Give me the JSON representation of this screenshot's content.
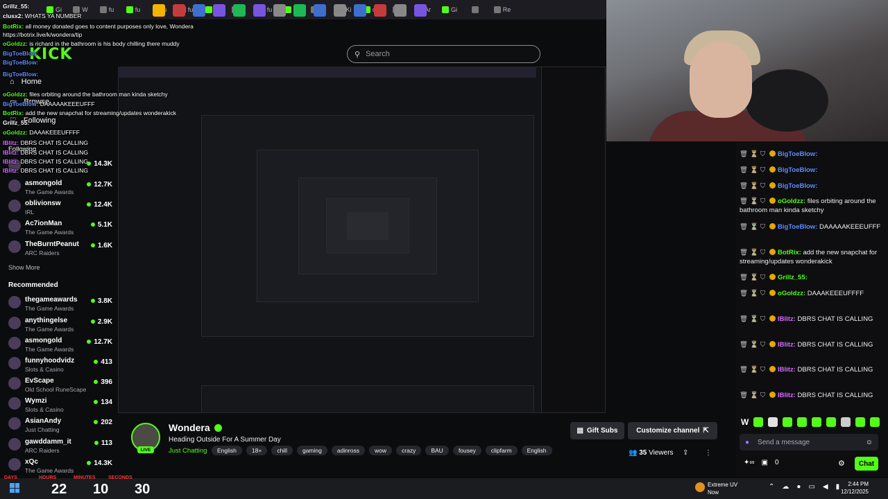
{
  "browser": {
    "tabs": [
      "Gi",
      "W",
      "fu",
      "fu",
      "fu",
      "fu",
      "fu",
      "fu",
      "fu",
      "fu",
      "fu",
      "Ki",
      "di",
      "",
      "Ar",
      "Gi",
      "",
      "Re"
    ]
  },
  "search": {
    "placeholder": "Search"
  },
  "overlay": {
    "lines": [
      {
        "user": "Grillz_55:",
        "text": "",
        "color": "#ffffff"
      },
      {
        "user": "clusx2:",
        "text": "WHATS YA NUMBER",
        "color": "#ffffff"
      },
      {
        "user": "BotRix:",
        "text": "all money donated goes to content purposes only love, Wondera",
        "color": "#53fc18"
      },
      {
        "user": "",
        "text": "https://botrix.live/k/wondera/tip",
        "color": "#ffffff"
      },
      {
        "user": "oGoldzz:",
        "text": "is richard in the bathroom is his body chilling there muddy",
        "color": "#53fc18"
      },
      {
        "user": "BigToeBlow:",
        "text": "",
        "color": "#5b8cff"
      },
      {
        "user": "BigToeBlow:",
        "text": "",
        "color": "#5b8cff"
      },
      {
        "user": "BigToeBlow:",
        "text": "",
        "color": "#5b8cff"
      },
      {
        "user": "oGoldzz:",
        "text": "files orbiting around the bathroom man kinda sketchy",
        "color": "#53fc18"
      },
      {
        "user": "BigToeBlow:",
        "text": "DAAAAAKEEEUFFF",
        "color": "#5b8cff"
      },
      {
        "user": "BotRix:",
        "text": "add the new snapchat for streaming/updates wonderakick",
        "color": "#53fc18"
      },
      {
        "user": "Grillz_55:",
        "text": "",
        "color": "#ffffff"
      },
      {
        "user": "oGoldzz:",
        "text": "DAAAKEEEUFFFF",
        "color": "#53fc18"
      },
      {
        "user": "IBlitz:",
        "text": "DBRS CHAT IS CALLING",
        "color": "#d26bff"
      },
      {
        "user": "IBlitz:",
        "text": "DBRS CHAT IS CALLING",
        "color": "#d26bff"
      },
      {
        "user": "IBlitz:",
        "text": "DBRS CHAT IS CALLING",
        "color": "#d26bff"
      },
      {
        "user": "IBlitz:",
        "text": "DBRS CHAT IS CALLING",
        "color": "#d26bff"
      }
    ]
  },
  "nav": {
    "logo": "KICK",
    "home": "Home",
    "browse": "Browse",
    "following": "Following",
    "following_section": "Following"
  },
  "sidebar": {
    "following": [
      {
        "name": "",
        "category": "",
        "viewers": "14.3K"
      },
      {
        "name": "asmongold",
        "category": "The Game Awards",
        "viewers": "12.7K"
      },
      {
        "name": "oblivionsw",
        "category": "IRL",
        "viewers": "12.4K"
      },
      {
        "name": "Ac7ionMan",
        "category": "The Game Awards",
        "viewers": "5.1K"
      },
      {
        "name": "TheBurntPeanut",
        "category": "ARC Raiders",
        "viewers": "1.6K"
      }
    ],
    "show_more": "Show More",
    "recommended_title": "Recommended",
    "recommended": [
      {
        "name": "thegameawards",
        "category": "The Game Awards",
        "viewers": "3.8K"
      },
      {
        "name": "anythingelse",
        "category": "The Game Awards",
        "viewers": "2.9K"
      },
      {
        "name": "asmongold",
        "category": "The Game Awards",
        "viewers": "12.7K"
      },
      {
        "name": "funnyhoodvidz",
        "category": "Slots & Casino",
        "viewers": "413"
      },
      {
        "name": "EvScape",
        "category": "Old School RuneScape",
        "viewers": "396"
      },
      {
        "name": "Wymzi",
        "category": "Slots & Casino",
        "viewers": "134"
      },
      {
        "name": "AsianAndy",
        "category": "Just Chatting",
        "viewers": "202"
      },
      {
        "name": "gawddamm_it",
        "category": "ARC Raiders",
        "viewers": "113"
      },
      {
        "name": "xQc",
        "category": "The Game Awards",
        "viewers": "14.3K"
      }
    ]
  },
  "chat": {
    "messages": [
      {
        "user": "BigToeBlow:",
        "text": "",
        "color": "#5b8cff"
      },
      {
        "user": "BigToeBlow:",
        "text": "",
        "color": "#5b8cff"
      },
      {
        "user": "BigToeBlow:",
        "text": "",
        "color": "#5b8cff"
      },
      {
        "user": "oGoldzz:",
        "text": "files orbiting around the bathroom man kinda sketchy",
        "color": "#53fc18"
      },
      {
        "user": "BigToeBlow:",
        "text": "DAAAAAKEEEUFFF",
        "color": "#5b8cff"
      },
      {
        "user": "BotRix:",
        "text": "add the new snapchat for streaming/updates wonderakick",
        "color": "#53fc18"
      },
      {
        "user": "Grillz_55:",
        "text": "",
        "color": "#53fc18"
      },
      {
        "user": "oGoldzz:",
        "text": "DAAAKEEEUFFFF",
        "color": "#53fc18"
      },
      {
        "user": "IBlitz:",
        "text": "DBRS CHAT IS CALLING",
        "color": "#d26bff"
      },
      {
        "user": "IBlitz:",
        "text": "DBRS CHAT IS CALLING",
        "color": "#d26bff"
      },
      {
        "user": "IBlitz:",
        "text": "DBRS CHAT IS CALLING",
        "color": "#d26bff"
      },
      {
        "user": "IBlitz:",
        "text": "DBRS CHAT IS CALLING",
        "color": "#d26bff"
      }
    ],
    "input_placeholder": "Send a message",
    "points": "0",
    "chat_button": "Chat"
  },
  "stream": {
    "name": "Wondera",
    "live": "LIVE",
    "title": "Heading Outside For A Summer Day",
    "category": "Just Chatting",
    "tags": [
      "English",
      "18+",
      "chill",
      "gaming",
      "adinross",
      "wow",
      "crazy",
      "BAU",
      "fousey",
      "clipfarm",
      "English"
    ],
    "gift_subs": "Gift Subs",
    "customize": "Customize channel",
    "viewers_count": "35",
    "viewers_label": "Viewers"
  },
  "countdown": {
    "labels": [
      "DAYS",
      "HOURS",
      "MINUTES",
      "SECONDS"
    ],
    "values": [
      "",
      "22",
      "10",
      "30"
    ]
  },
  "taskbar": {
    "weather_title": "Extreme UV",
    "weather_sub": "Now",
    "time": "2:44 PM",
    "date": "12/12/2025"
  },
  "colors": {
    "accent": "#53fc18",
    "background": "#0b0c0e"
  }
}
